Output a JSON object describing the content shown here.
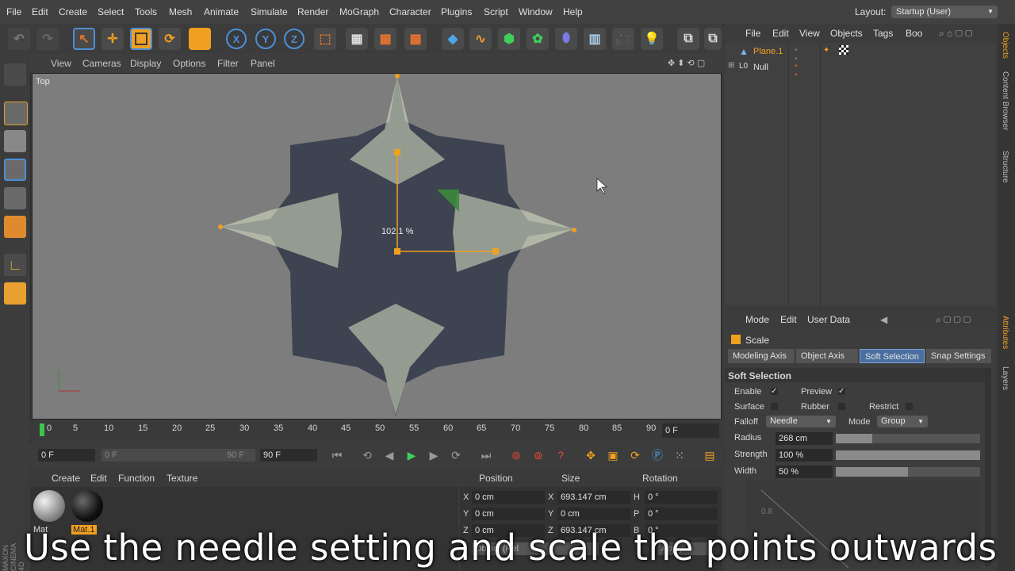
{
  "menubar": {
    "items": [
      "File",
      "Edit",
      "Create",
      "Select",
      "Tools",
      "Mesh",
      "Animate",
      "Simulate",
      "Render",
      "MoGraph",
      "Character",
      "Plugins",
      "Script",
      "Window",
      "Help"
    ],
    "layout_label": "Layout:",
    "layout_value": "Startup (User)"
  },
  "toolbar": {
    "axis_x": "X",
    "axis_y": "Y",
    "axis_z": "Z"
  },
  "viewport": {
    "menu": [
      "View",
      "Cameras",
      "Display",
      "Options",
      "Filter",
      "Panel"
    ],
    "label": "Top",
    "scale_readout": "102.1 %"
  },
  "timeline": {
    "ticks": [
      "0",
      "5",
      "10",
      "15",
      "20",
      "25",
      "30",
      "35",
      "40",
      "45",
      "50",
      "55",
      "60",
      "65",
      "70",
      "75",
      "80",
      "85",
      "90"
    ],
    "current_frame": "0 F",
    "start_field": "0 F",
    "range_start": "0 F",
    "range_end": "90 F",
    "end_field": "90 F"
  },
  "materials": {
    "menu": [
      "Create",
      "Edit",
      "Function",
      "Texture"
    ],
    "items": [
      {
        "name": "Mat",
        "selected": false
      },
      {
        "name": "Mat.1",
        "selected": true
      }
    ]
  },
  "coordinates": {
    "headers": [
      "Position",
      "Size",
      "Rotation"
    ],
    "rows": [
      {
        "axis": "X",
        "pos": "0 cm",
        "size_axis": "X",
        "size": "693.147 cm",
        "rot_axis": "H",
        "rot": "0 °"
      },
      {
        "axis": "Y",
        "pos": "0 cm",
        "size_axis": "Y",
        "size": "0 cm",
        "rot_axis": "P",
        "rot": "0 °"
      },
      {
        "axis": "Z",
        "pos": "0 cm",
        "size_axis": "Z",
        "size": "693.147 cm",
        "rot_axis": "B",
        "rot": "0 °"
      }
    ],
    "object_dropdown": "Object (Rel",
    "apply_button": "Apply"
  },
  "objects": {
    "menu": [
      "File",
      "Edit",
      "View",
      "Objects",
      "Tags",
      "Boo"
    ],
    "items": [
      {
        "name": "Plane.1",
        "active": true
      },
      {
        "name": "Null",
        "active": false
      }
    ]
  },
  "side_tabs": {
    "top": [
      "Objects",
      "Content Browser",
      "Structure"
    ],
    "bottom": [
      "Attributes",
      "Layers"
    ]
  },
  "attributes": {
    "menu": [
      "Mode",
      "Edit",
      "User Data"
    ],
    "title": "Scale",
    "tabs": [
      "Modeling Axis",
      "Object Axis",
      "Soft Selection",
      "Snap Settings"
    ],
    "active_tab": "Soft Selection",
    "section": "Soft Selection",
    "enable_label": "Enable",
    "preview_label": "Preview",
    "surface_label": "Surface",
    "rubber_label": "Rubber",
    "restrict_label": "Restrict",
    "falloff_label": "Falloff",
    "falloff_value": "Needle",
    "mode_label": "Mode",
    "mode_value": "Group",
    "radius_label": "Radius",
    "radius_value": "268 cm",
    "radius_fraction": 0.25,
    "strength_label": "Strength",
    "strength_value": "100 %",
    "strength_fraction": 1.0,
    "width_label": "Width",
    "width_value": "50 %",
    "width_fraction": 0.5,
    "graph_tick": "0.8"
  },
  "brand": "MAXON CINEMA 4D",
  "caption": "Use the needle setting and scale the points outwards"
}
